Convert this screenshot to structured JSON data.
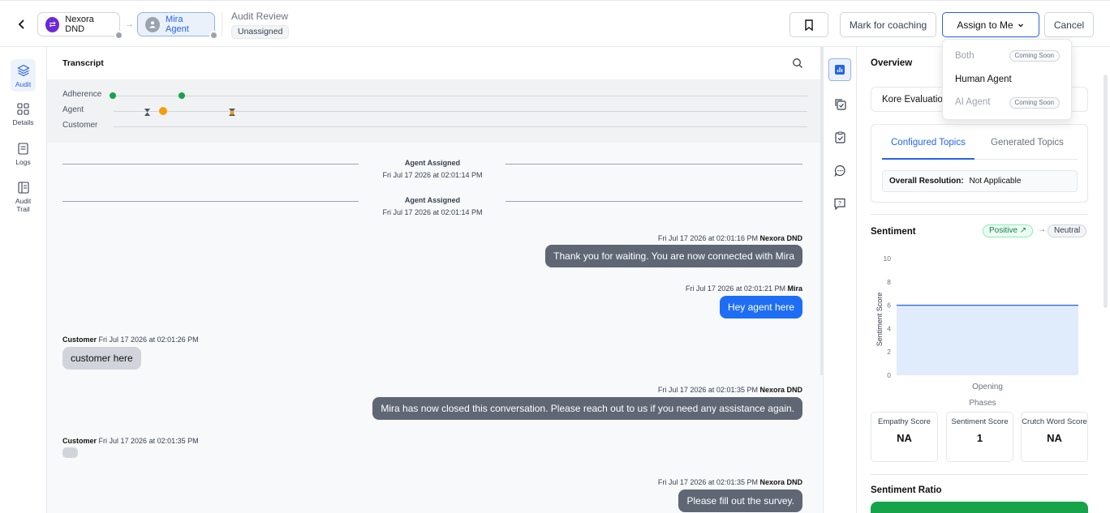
{
  "breadcrumb": {
    "bot_label": "Nexora DND",
    "agent_label": "Mira Agent"
  },
  "audit": {
    "title": "Audit Review",
    "status": "Unassigned"
  },
  "toolbar": {
    "coaching_label": "Mark for coaching",
    "assign_label": "Assign to Me",
    "cancel_label": "Cancel"
  },
  "assign_menu": {
    "items": [
      {
        "label": "Both",
        "badge": "Coming Soon",
        "enabled": false
      },
      {
        "label": "Human Agent",
        "badge": "",
        "enabled": true
      },
      {
        "label": "AI Agent",
        "badge": "Coming Soon",
        "enabled": false
      }
    ]
  },
  "nav": {
    "items": [
      {
        "label": "Audit",
        "icon": "layers-icon",
        "active": true
      },
      {
        "label": "Details",
        "icon": "grid-icon"
      },
      {
        "label": "Logs",
        "icon": "document-icon"
      },
      {
        "label": "Audit Trail",
        "icon": "list-icon"
      }
    ]
  },
  "transcript": {
    "title": "Transcript",
    "timeline": {
      "rows": [
        "Adherence",
        "Agent",
        "Customer"
      ]
    },
    "messages": [
      {
        "type": "system",
        "title": "Agent Assigned",
        "time": "Fri Jul 17 2026 at 02:01:14 PM"
      },
      {
        "type": "system",
        "title": "Agent Assigned",
        "time": "Fri Jul 17 2026 at 02:01:14 PM"
      },
      {
        "type": "bot",
        "time": "Fri Jul 17 2026 at 02:01:16 PM",
        "sender": "Nexora DND",
        "text": "Thank you for waiting. You are now connected with Mira"
      },
      {
        "type": "agent",
        "time": "Fri Jul 17 2026 at 02:01:21 PM",
        "sender": "Mira",
        "text": "Hey agent here"
      },
      {
        "type": "customer",
        "sender": "Customer",
        "time": "Fri Jul 17 2026 at 02:01:26 PM",
        "text": "customer here"
      },
      {
        "type": "bot",
        "time": "Fri Jul 17 2026 at 02:01:35 PM",
        "sender": "Nexora DND",
        "text": "Mira has now closed this conversation. Please reach out to us if you need any assistance again."
      },
      {
        "type": "customer",
        "sender": "Customer",
        "time": "Fri Jul 17 2026 at 02:01:35 PM",
        "text": ""
      },
      {
        "type": "bot",
        "time": "Fri Jul 17 2026 at 02:01:35 PM",
        "sender": "Nexora DND",
        "text": "Please fill out the survey."
      }
    ]
  },
  "overview": {
    "title": "Overview",
    "evaluation_label": "Kore Evaluatio",
    "tabs": [
      {
        "label": "Configured Topics",
        "active": true
      },
      {
        "label": "Generated Topics",
        "active": false
      }
    ],
    "resolution_label": "Overall Resolution:",
    "resolution_value": "Not Applicable"
  },
  "sentiment": {
    "title": "Sentiment",
    "from": "Positive ↗",
    "to": "Neutral",
    "scores": [
      {
        "label": "Empathy Score",
        "value": "NA"
      },
      {
        "label": "Sentiment Score",
        "value": "1"
      },
      {
        "label": "Crutch Word Score",
        "value": "NA"
      }
    ],
    "ratio_title": "Sentiment Ratio"
  },
  "chart_data": {
    "type": "area",
    "categories": [
      "Opening"
    ],
    "values": [
      6
    ],
    "xlabel": "Phases",
    "ylabel": "Sentiment Score",
    "ylim": [
      0,
      10
    ],
    "yticks": [
      "10",
      "8",
      "6",
      "4",
      "2",
      "0"
    ],
    "color": "#2563eb"
  }
}
